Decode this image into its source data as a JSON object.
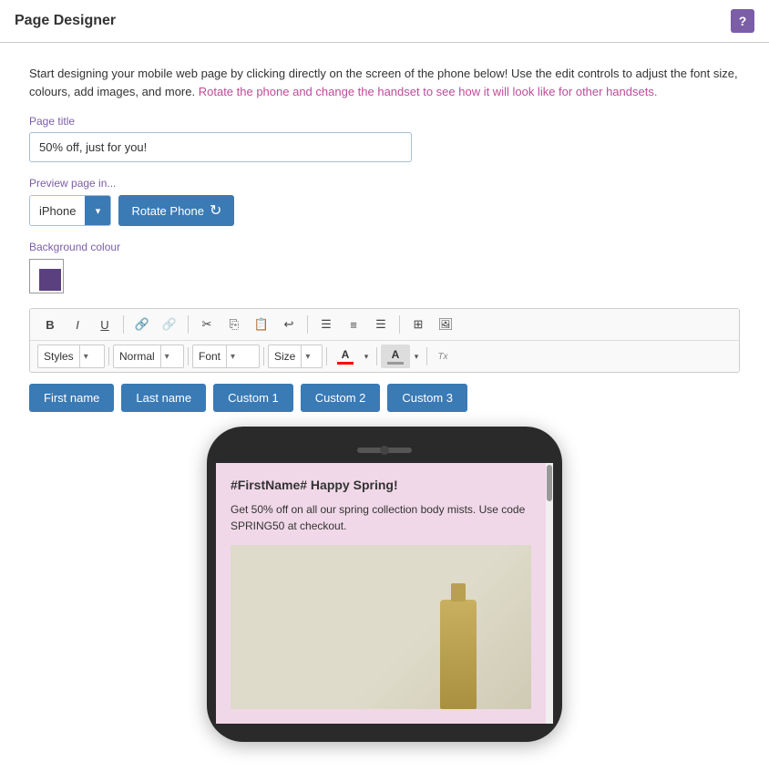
{
  "window": {
    "title": "Page Designer",
    "help_button_label": "?"
  },
  "intro": {
    "text_part1": "Start designing your mobile web page by clicking directly on the screen of the phone below! Use the edit controls to adjust the font size, colours, add images, and more.",
    "text_part2": "Rotate the phone and change the handset to see how it will look like for other handsets."
  },
  "page_title_label": "Page title",
  "page_title_value": "50% off, just for you!",
  "preview_label": "Preview page in...",
  "iphone_option": "iPhone",
  "rotate_button": "Rotate Phone",
  "bg_colour_label": "Background colour",
  "toolbar": {
    "bold": "B",
    "italic": "I",
    "underline": "U",
    "styles_label": "Styles",
    "styles_dropdown_arrow": "▾",
    "normal_label": "Normal",
    "normal_dropdown_arrow": "▾",
    "font_label": "Font",
    "font_dropdown_arrow": "▾",
    "size_label": "Size",
    "size_dropdown_arrow": "▾",
    "font_color_label": "A",
    "bg_color_label": "A",
    "clear_format_label": "Tx"
  },
  "merge_tags": [
    "First name",
    "Last name",
    "Custom 1",
    "Custom 2",
    "Custom 3"
  ],
  "phone": {
    "heading": "#FirstName# Happy Spring!",
    "body_text": "Get 50% off on all our spring collection body mists. Use code SPRING50 at checkout."
  }
}
